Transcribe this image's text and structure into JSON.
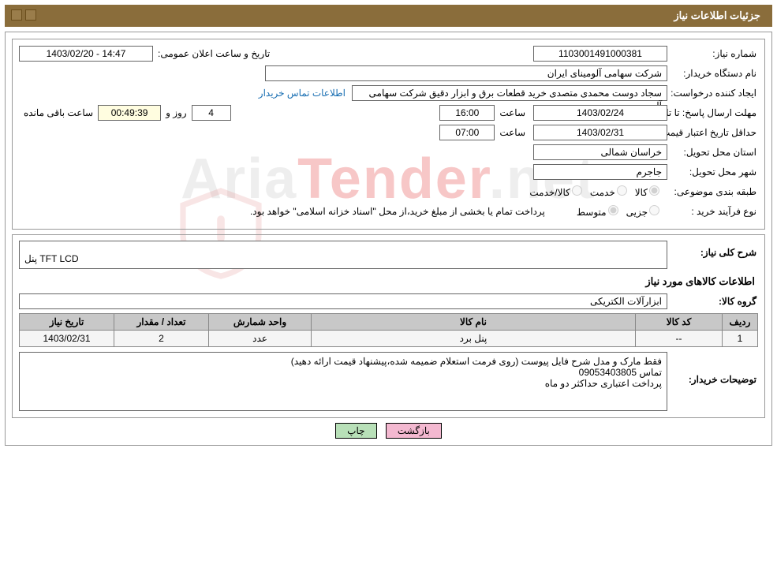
{
  "header": {
    "title": "جزئیات اطلاعات نیاز"
  },
  "labels": {
    "need_no": "شماره نیاز:",
    "announce_dt": "تاریخ و ساعت اعلان عمومی:",
    "buyer_org": "نام دستگاه خریدار:",
    "requester": "ایجاد کننده درخواست:",
    "buyer_contact": "اطلاعات تماس خریدار",
    "reply_deadline": "مهلت ارسال پاسخ:",
    "to_date": "تا تاریخ:",
    "hour": "ساعت",
    "days_and": "روز و",
    "hours_remain": "ساعت باقی مانده",
    "price_valid": "حداقل تاریخ اعتبار قیمت:",
    "province": "استان محل تحویل:",
    "city": "شهر محل تحویل:",
    "category": "طبقه بندی موضوعی:",
    "purchase_type": "نوع فرآیند خرید :",
    "cat_goods": "کالا",
    "cat_service": "خدمت",
    "cat_goods_service": "کالا/خدمت",
    "pt_partial": "جزیی",
    "pt_medium": "متوسط",
    "payment_note": "پرداخت تمام یا بخشی از مبلغ خرید،از محل \"اسناد خزانه اسلامی\" خواهد بود.",
    "need_summary": "شرح کلی نیاز:",
    "goods_info": "اطلاعات کالاهای مورد نیاز",
    "goods_group": "گروه کالا:",
    "buyer_notes": "توضیحات خریدار:"
  },
  "values": {
    "need_no": "1103001491000381",
    "announce_dt": "1403/02/20 - 14:47",
    "buyer_org": "شرکت سهامی آلومینای ایران",
    "requester": "سجاد دوست محمدی متصدی خرید قطعات برق و ابزار دقیق شرکت سهامی آلود",
    "reply_to_date": "1403/02/24",
    "reply_hour": "16:00",
    "remain_days": "4",
    "remain_time": "00:49:39",
    "price_valid_date": "1403/02/31",
    "price_valid_hour": "07:00",
    "province": "خراسان شمالی",
    "city": "جاجرم",
    "need_summary": "پنل TFT LCD",
    "goods_group": "ابزارآلات الکتریکی",
    "buyer_notes": "فقط مارک و مدل شرح فایل پیوست (روی فرمت استعلام ضمیمه شده،پیشنهاد قیمت ارائه دهید)\nتماس 09053403805\nپرداخت اعتباری حداکثر دو ماه"
  },
  "table": {
    "headers": {
      "row": "ردیف",
      "code": "کد کالا",
      "name": "نام کالا",
      "unit": "واحد شمارش",
      "qty": "تعداد / مقدار",
      "need_date": "تاریخ نیاز"
    },
    "rows": [
      {
        "row": "1",
        "code": "--",
        "name": "پنل برد",
        "unit": "عدد",
        "qty": "2",
        "need_date": "1403/02/31"
      }
    ]
  },
  "buttons": {
    "print": "چاپ",
    "back": "بازگشت"
  },
  "watermark": {
    "text_pre": "Aria",
    "text_mid": "Tender",
    "text_post": ".net"
  }
}
